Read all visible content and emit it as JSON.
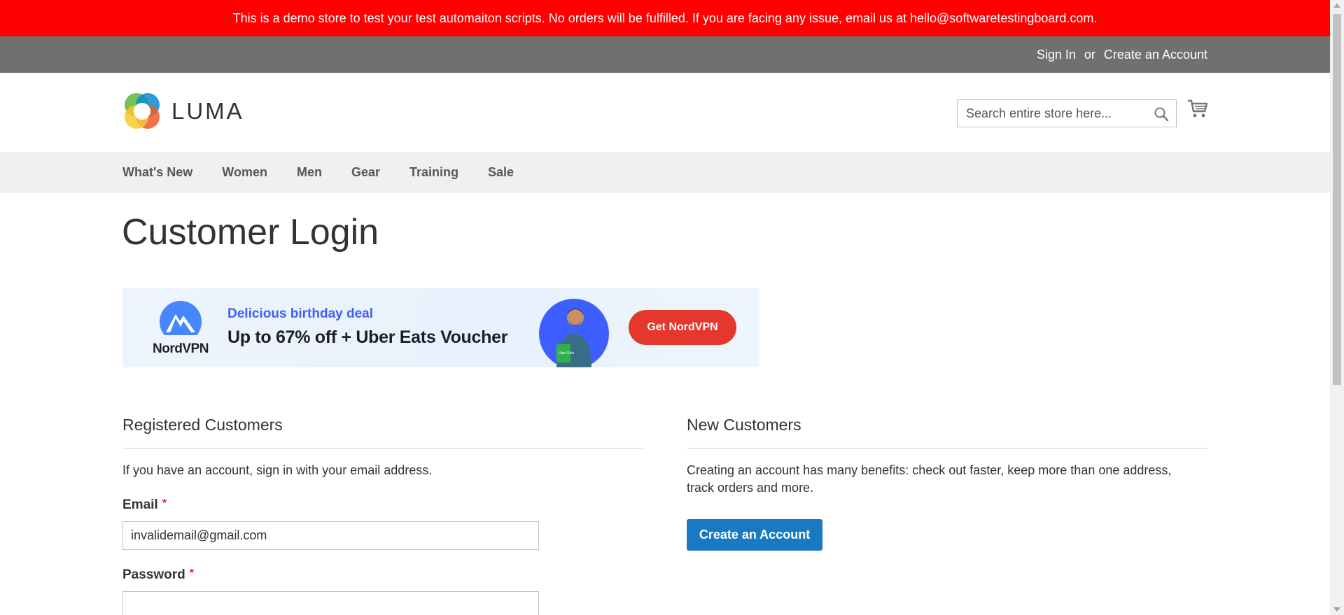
{
  "demo_notice": "This is a demo store to test your test automaiton scripts. No orders will be fulfilled. If you are facing any issue, email us at hello@softwaretestingboard.com.",
  "top_links": {
    "sign_in": "Sign In",
    "or": "or",
    "create_account": "Create an Account"
  },
  "header": {
    "logo_text": "LUMA",
    "search_placeholder": "Search entire store here..."
  },
  "nav": {
    "items": [
      "What's New",
      "Women",
      "Men",
      "Gear",
      "Training",
      "Sale"
    ]
  },
  "page_title": "Customer Login",
  "banner": {
    "brand": "NordVPN",
    "subtitle": "Delicious birthday deal",
    "headline": "Up to 67% off + Uber Eats Voucher",
    "button": "Get NordVPN",
    "bag_text": "Uber Eats"
  },
  "registered": {
    "title": "Registered Customers",
    "intro": "If you have an account, sign in with your email address.",
    "email_label": "Email",
    "email_value": "invalidemail@gmail.com",
    "password_label": "Password",
    "required_mark": "*"
  },
  "new_customers": {
    "title": "New Customers",
    "text": "Creating an account has many benefits: check out faster, keep more than one address, track orders and more.",
    "button": "Create an Account"
  },
  "colors": {
    "demo_bar": "#ff0000",
    "top_bar": "#6e716e",
    "primary": "#1979c3",
    "nord_button": "#e5372c"
  }
}
